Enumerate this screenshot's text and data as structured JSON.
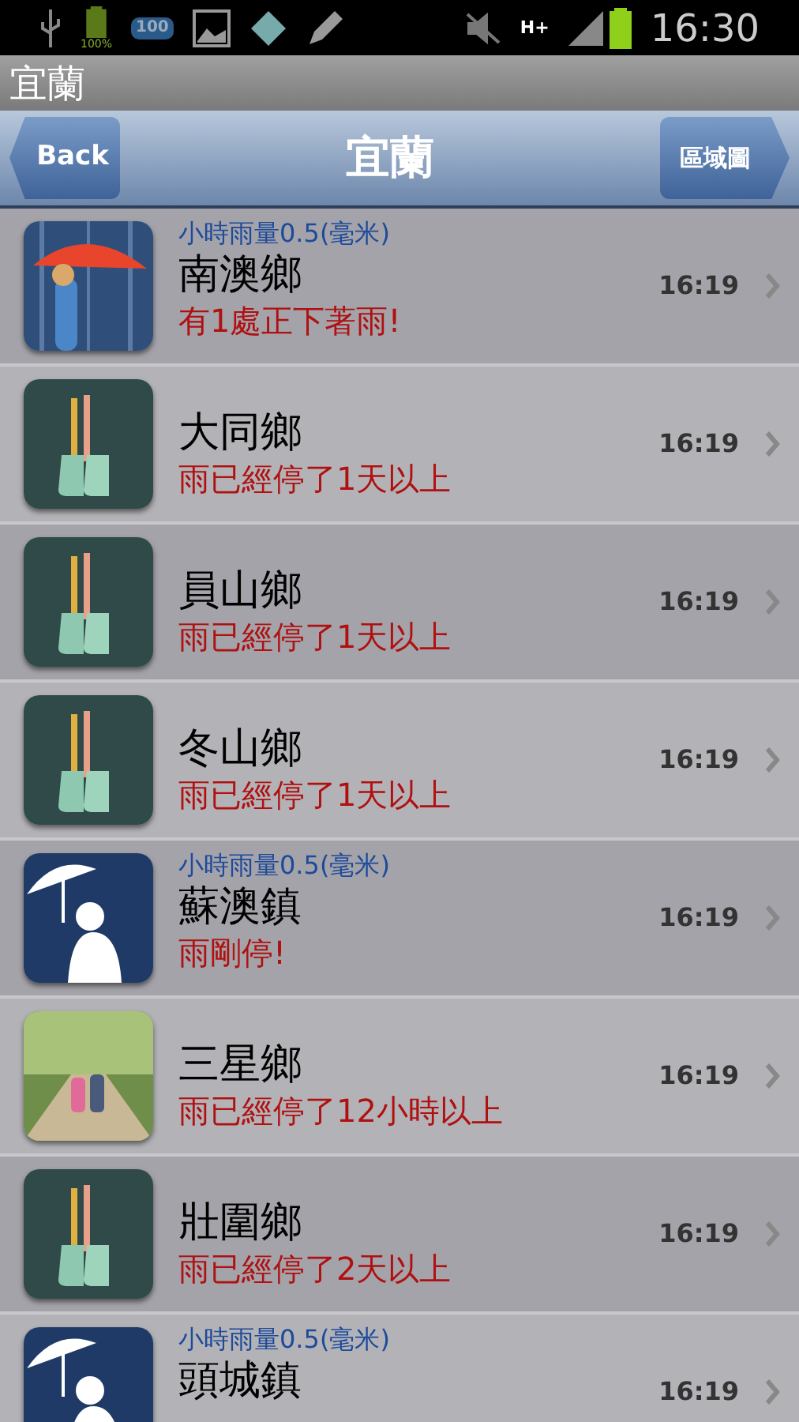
{
  "status_bar": {
    "battery_label": "100%",
    "badge": "100",
    "network": "H+",
    "time": "16:30"
  },
  "app_title": "宜蘭",
  "nav": {
    "back": "Back",
    "title": "宜蘭",
    "map_button": "區域圖"
  },
  "rows": [
    {
      "kind": "rain",
      "rainfall": "小時雨量0.5(毫米)",
      "name": "南澳鄉",
      "status": "有1處正下著雨!",
      "time": "16:19"
    },
    {
      "kind": "boots",
      "name": "大同鄉",
      "status": "雨已經停了1天以上",
      "time": "16:19"
    },
    {
      "kind": "boots",
      "name": "員山鄉",
      "status": "雨已經停了1天以上",
      "time": "16:19"
    },
    {
      "kind": "boots",
      "name": "冬山鄉",
      "status": "雨已經停了1天以上",
      "time": "16:19"
    },
    {
      "kind": "umbrella",
      "rainfall": "小時雨量0.5(毫米)",
      "name": "蘇澳鎮",
      "status": "雨剛停!",
      "time": "16:19"
    },
    {
      "kind": "walk",
      "name": "三星鄉",
      "status": "雨已經停了12小時以上",
      "time": "16:19"
    },
    {
      "kind": "boots",
      "name": "壯圍鄉",
      "status": "雨已經停了2天以上",
      "time": "16:19"
    },
    {
      "kind": "umbrella",
      "rainfall": "小時雨量0.5(毫米)",
      "name": "頭城鎮",
      "time": "16:19"
    }
  ]
}
